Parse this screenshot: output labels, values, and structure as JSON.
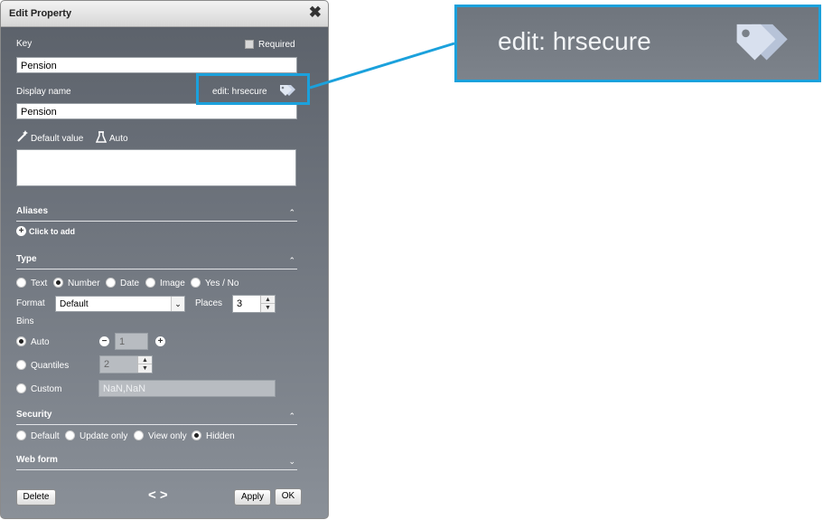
{
  "dialog": {
    "title": "Edit Property",
    "key_label": "Key",
    "required_label": "Required",
    "key_value": "Pension",
    "display_name_label": "Display name",
    "edit_tag_label": "edit: hrsecure",
    "display_name_value": "Pension",
    "default_value_label": "Default value",
    "auto_label": "Auto",
    "default_value_text": ""
  },
  "aliases": {
    "title": "Aliases",
    "click_to_add": "Click to add"
  },
  "type": {
    "title": "Type",
    "options": [
      "Text",
      "Number",
      "Date",
      "Image",
      "Yes / No"
    ],
    "selected": "Number",
    "format_label": "Format",
    "format_value": "Default",
    "places_label": "Places",
    "places_value": "3"
  },
  "bins": {
    "title": "Bins",
    "auto_label": "Auto",
    "auto_value": "1",
    "quantiles_label": "Quantiles",
    "quantiles_value": "2",
    "custom_label": "Custom",
    "custom_value": "NaN,NaN",
    "selected": "Auto"
  },
  "security": {
    "title": "Security",
    "options": [
      "Default",
      "Update only",
      "View only",
      "Hidden"
    ],
    "selected": "Hidden"
  },
  "web_form": {
    "title": "Web form"
  },
  "footer": {
    "delete": "Delete",
    "apply": "Apply",
    "ok": "OK",
    "nav": "< >"
  },
  "zoom_callout": {
    "text": "edit: hrsecure"
  },
  "colors": {
    "highlight": "#1ba1dc",
    "panel_top": "#5a6069",
    "panel_bottom": "#8a9098"
  }
}
